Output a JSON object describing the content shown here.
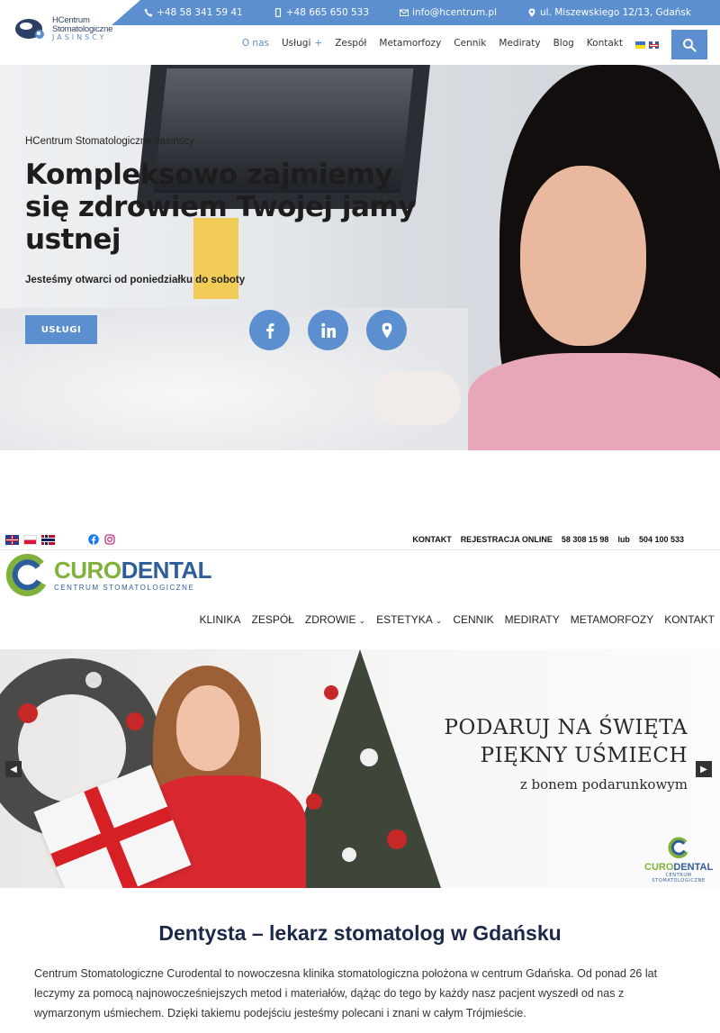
{
  "hcentrum": {
    "logo": {
      "line1": "HCentrum",
      "line2": "Stomatologiczne",
      "line3": "JASINSCY"
    },
    "topbar": {
      "phone1": "+48 58 341 59 41",
      "phone2": "+48 665 650 533",
      "email": "info@hcentrum.pl",
      "address": "ul. Miszewskiego 12/13, Gdańsk"
    },
    "nav": [
      "O nas",
      "Usługi",
      "Zespół",
      "Metamorfozy",
      "Cennik",
      "Mediraty",
      "Blog",
      "Kontakt"
    ],
    "nav_plus": "+",
    "hero": {
      "subtitle": "HCentrum Stomatologiczne Jasińscy",
      "title": "Kompleksowo zajmiemy się zdrowiem Twojej jamy ustnej",
      "open": "Jesteśmy otwarci od poniedziałku do soboty",
      "button": "USŁUGI"
    },
    "icons": [
      "phone-icon",
      "mobile-icon",
      "envelope-icon",
      "map-pin-icon",
      "search-icon",
      "facebook-icon",
      "linkedin-icon",
      "location-icon"
    ],
    "colors": {
      "accent": "#5b8fcf",
      "dark": "#2d3f66"
    }
  },
  "curodental": {
    "topbar": {
      "contact": "KONTAKT",
      "registration": "REJESTRACJA ONLINE",
      "phone1": "58 308 15 98",
      "or": "lub",
      "phone2": "504 100 533"
    },
    "logo": {
      "name_a": "CURO",
      "name_b": "DENTAL",
      "tagline": "CENTRUM STOMATOLOGICZNE"
    },
    "nav": [
      {
        "label": "KLINIKA"
      },
      {
        "label": "ZESPÓŁ"
      },
      {
        "label": "ZDROWIE",
        "dropdown": "⌄"
      },
      {
        "label": "ESTETYKA",
        "dropdown": "⌄"
      },
      {
        "label": "CENNIK"
      },
      {
        "label": "MEDIRATY"
      },
      {
        "label": "METAMORFOZY"
      },
      {
        "label": "KONTAKT"
      }
    ],
    "hero": {
      "line1": "PODARUJ NA ŚWIĘTA",
      "line2": "PIĘKNY UŚMIECH",
      "line3": "z bonem podarunkowym",
      "prev": "◀",
      "next": "▶",
      "mini_logo_a": "CURO",
      "mini_logo_b": "DENTAL",
      "mini_logo_tag": "CENTRUM STOMATOLOGICZNE"
    },
    "heading": "Dentysta – lekarz stomatolog w Gdańsku",
    "paragraph": "Centrum Stomatologiczne Curodental to nowoczesna klinika stomatologiczna położona w centrum Gdańska. Od ponad 26 lat leczymy za pomocą najnowocześniejszych metod i materiałów, dążąc do tego by każdy nasz pacjent wyszedł od nas  z wymarzonym uśmiechem. Dzięki takiemu podejściu jesteśmy polecani i znani w całym Trójmieście.",
    "colors": {
      "green": "#7fb13b",
      "blue": "#2d5e9b",
      "heading": "#1c2848"
    }
  }
}
